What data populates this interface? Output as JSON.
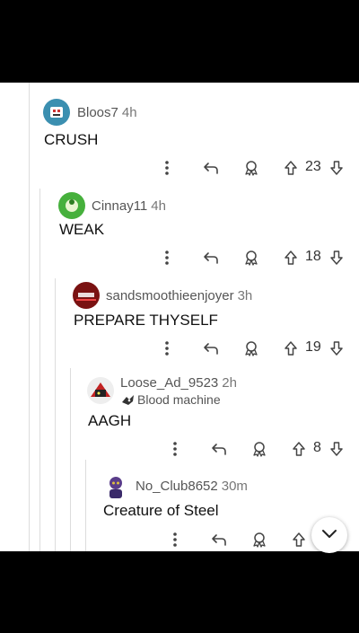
{
  "comments": [
    {
      "user": "Bloos7",
      "time": "4h",
      "flair": "",
      "text": "CRUSH",
      "score": "23",
      "colors": {
        "avatar_bg": "#3b8fb0",
        "avatar_fg": "#ffffff"
      }
    },
    {
      "user": "Cinnay11",
      "time": "4h",
      "flair": "",
      "text": "WEAK",
      "score": "18",
      "colors": {
        "avatar_bg": "#46b03c",
        "avatar_fg": "#e8f5d0"
      }
    },
    {
      "user": "sandsmoothieenjoyer",
      "time": "3h",
      "flair": "",
      "text": "PREPARE THYSELF",
      "score": "19",
      "colors": {
        "avatar_bg": "#7a1212",
        "avatar_fg": "#ffffff"
      }
    },
    {
      "user": "Loose_Ad_9523",
      "time": "2h",
      "flair": "Blood machine",
      "text": "AAGH",
      "score": "8",
      "colors": {
        "avatar_bg": "#c22222",
        "avatar_fg": "#222222"
      }
    },
    {
      "user": "No_Club8652",
      "time": "30m",
      "flair": "",
      "text": "Creature of Steel",
      "score": "",
      "colors": {
        "avatar_bg": "#5a3d8a",
        "avatar_fg": "#e0c040"
      }
    }
  ],
  "icons": {
    "more": "more-vert-icon",
    "reply": "reply-icon",
    "award": "award-icon",
    "upvote": "upvote-arrow-icon",
    "downvote": "downvote-arrow-icon",
    "scroll": "chevron-down-icon",
    "flair": "robot-flair-icon"
  }
}
